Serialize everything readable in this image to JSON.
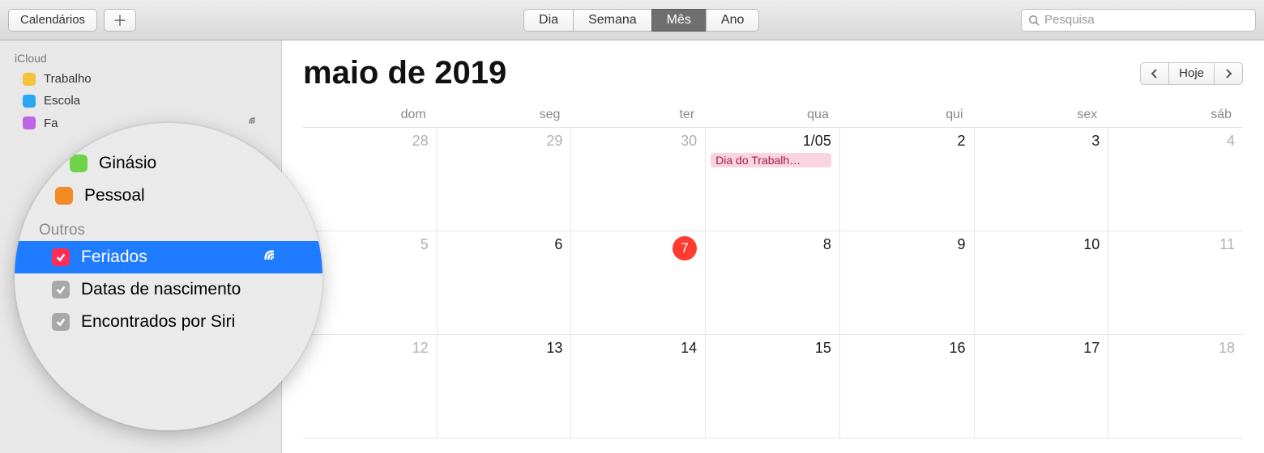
{
  "toolbar": {
    "calendars_label": "Calendários",
    "views": {
      "day": "Dia",
      "week": "Semana",
      "month": "Mês",
      "year": "Ano",
      "active": "month"
    },
    "search_placeholder": "Pesquisa"
  },
  "sidebar": {
    "section1": "iCloud",
    "items": [
      {
        "label": "Trabalho",
        "color": "#f5c23e"
      },
      {
        "label": "Escola",
        "color": "#2aa7f0"
      },
      {
        "label": "Fa",
        "color": "#c063e6",
        "cut": true,
        "shared": true
      }
    ]
  },
  "magnifier": {
    "top": [
      {
        "label": "Ginásio",
        "color": "#6fd34a"
      },
      {
        "label": "Pessoal",
        "color": "#f28b24"
      }
    ],
    "section": "Outros",
    "rows": [
      {
        "label": "Feriados",
        "color": "#ff2d55",
        "checked": true,
        "shared": true,
        "selected": true
      },
      {
        "label": "Datas de nascimento",
        "gray": true,
        "checked": true
      },
      {
        "label": "Encontrados por Siri",
        "gray": true,
        "checked": true
      }
    ]
  },
  "content": {
    "month_title": "maio de 2019",
    "today_label": "Hoje",
    "dow": [
      "dom",
      "seg",
      "ter",
      "qua",
      "qui",
      "sex",
      "sáb"
    ],
    "weeks": [
      [
        {
          "n": "28",
          "dim": true
        },
        {
          "n": "29",
          "dim": true
        },
        {
          "n": "30",
          "dim": true
        },
        {
          "n": "1/05",
          "event": "Dia do Trabalh…"
        },
        {
          "n": "2"
        },
        {
          "n": "3"
        },
        {
          "n": "4",
          "dim": true
        }
      ],
      [
        {
          "n": "5",
          "dim": true
        },
        {
          "n": "6"
        },
        {
          "n": "7",
          "today": true
        },
        {
          "n": "8"
        },
        {
          "n": "9"
        },
        {
          "n": "10"
        },
        {
          "n": "11",
          "dim": true
        }
      ],
      [
        {
          "n": "12",
          "dim": true
        },
        {
          "n": "13"
        },
        {
          "n": "14"
        },
        {
          "n": "15"
        },
        {
          "n": "16"
        },
        {
          "n": "17"
        },
        {
          "n": "18",
          "dim": true
        }
      ]
    ]
  }
}
